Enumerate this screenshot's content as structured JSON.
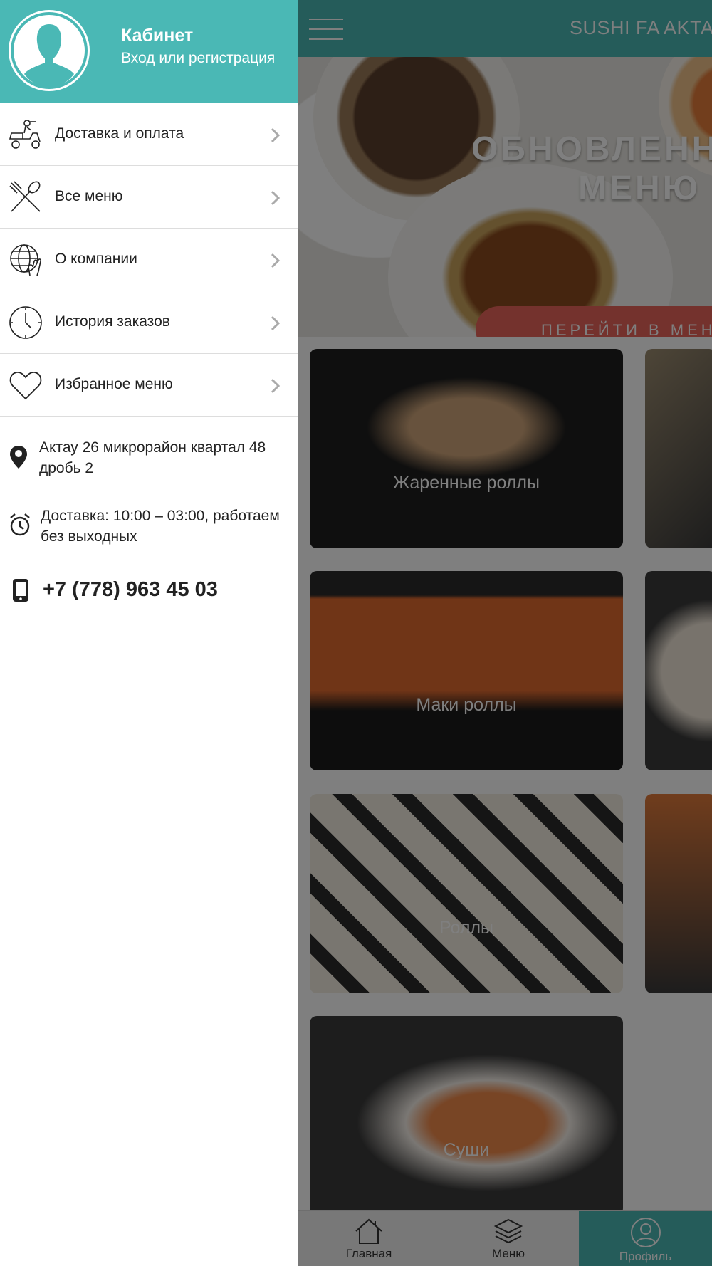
{
  "app": {
    "title": "SUSHI FA AKTAU",
    "banner": {
      "headline_line1": "ОБНОВЛЕННОЕ",
      "headline_line2": "МЕНЮ",
      "cta": "ПЕРЕЙТИ В МЕНЮ"
    },
    "categories": [
      {
        "label": "Жаренные роллы"
      },
      {
        "label": "Маки роллы"
      },
      {
        "label": "Роллы"
      },
      {
        "label": "Суши"
      }
    ],
    "bottom_nav": [
      {
        "label": "Главная",
        "icon": "home-icon"
      },
      {
        "label": "Меню",
        "icon": "layers-icon"
      },
      {
        "label": "Профиль",
        "icon": "user-icon",
        "active": true
      }
    ]
  },
  "drawer": {
    "header": {
      "title": "Кабинет",
      "subtitle": "Вход или регистрация"
    },
    "items": [
      {
        "label": "Доставка и оплата",
        "icon": "delivery-scooter-icon"
      },
      {
        "label": "Все меню",
        "icon": "fork-spoon-icon"
      },
      {
        "label": "О компании",
        "icon": "globe-hand-icon"
      },
      {
        "label": "История заказов",
        "icon": "clock-icon"
      },
      {
        "label": "Избранное меню",
        "icon": "heart-icon"
      }
    ],
    "info": {
      "address": "Актау 26 микрорайон квартал 48 дробь 2",
      "hours": "Доставка: 10:00 – 03:00, работаем без выходных",
      "phone": "+7 (778) 963 45 03"
    }
  },
  "colors": {
    "accent": "#4ab8b5",
    "cta": "#e8655a",
    "overlay": "rgba(0,0,0,0.5)"
  }
}
